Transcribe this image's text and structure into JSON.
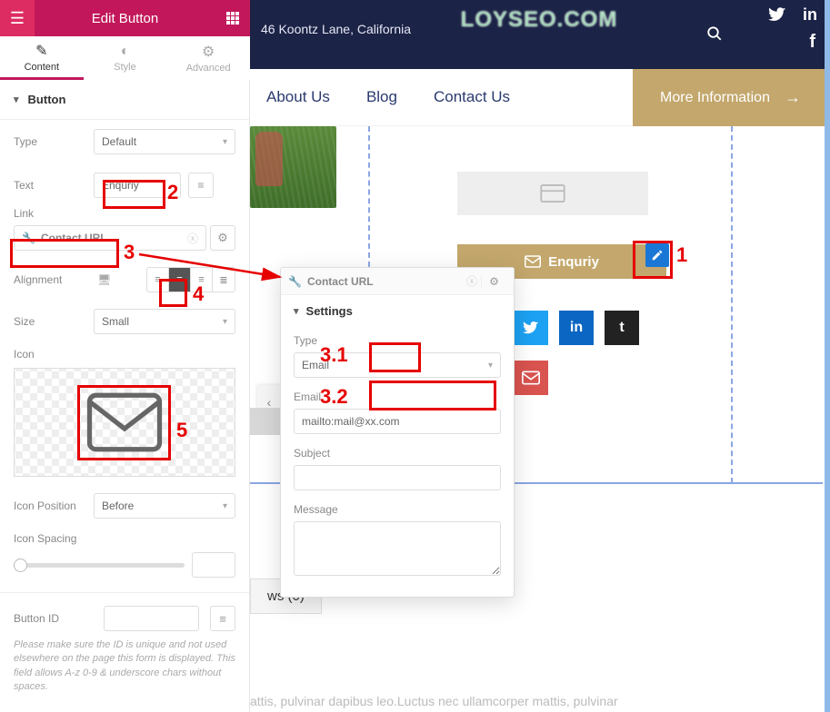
{
  "header": {
    "title": "Edit Button"
  },
  "tabs": {
    "content": "Content",
    "style": "Style",
    "advanced": "Advanced"
  },
  "section_label": "Button",
  "controls": {
    "type_label": "Type",
    "type_value": "Default",
    "text_label": "Text",
    "text_value": "Enquriy",
    "link_label": "Link",
    "link_value": "Contact URL",
    "alignment_label": "Alignment",
    "size_label": "Size",
    "size_value": "Small",
    "icon_label": "Icon",
    "icon_position_label": "Icon Position",
    "icon_position_value": "Before",
    "icon_spacing_label": "Icon Spacing",
    "button_id_label": "Button ID",
    "button_id_note": "Please make sure the ID is unique and not used elsewhere on the page this form is displayed. This field allows A-z 0-9 & underscore chars without spaces."
  },
  "popup": {
    "title": "Contact URL",
    "settings_label": "Settings",
    "type_label": "Type",
    "type_value": "Email",
    "email_label": "Email",
    "email_value": "mailto:mail@xx.com",
    "subject_label": "Subject",
    "message_label": "Message"
  },
  "preview": {
    "address": "46 Koontz Lane, California",
    "logo_text": "LOYSEO.COM",
    "nav": {
      "about": "About Us",
      "blog": "Blog",
      "contact": "Contact Us",
      "more_info": "More Information"
    },
    "enquiry_label": "Enquriy",
    "reviews_tab": "ws (0)",
    "lorem": "attis, pulvinar dapibus leo.Luctus nec ullamcorper mattis, pulvinar"
  },
  "annotations": {
    "n1": "1",
    "n2": "2",
    "n3": "3",
    "n31": "3.1",
    "n32": "3.2",
    "n4": "4",
    "n5": "5"
  }
}
